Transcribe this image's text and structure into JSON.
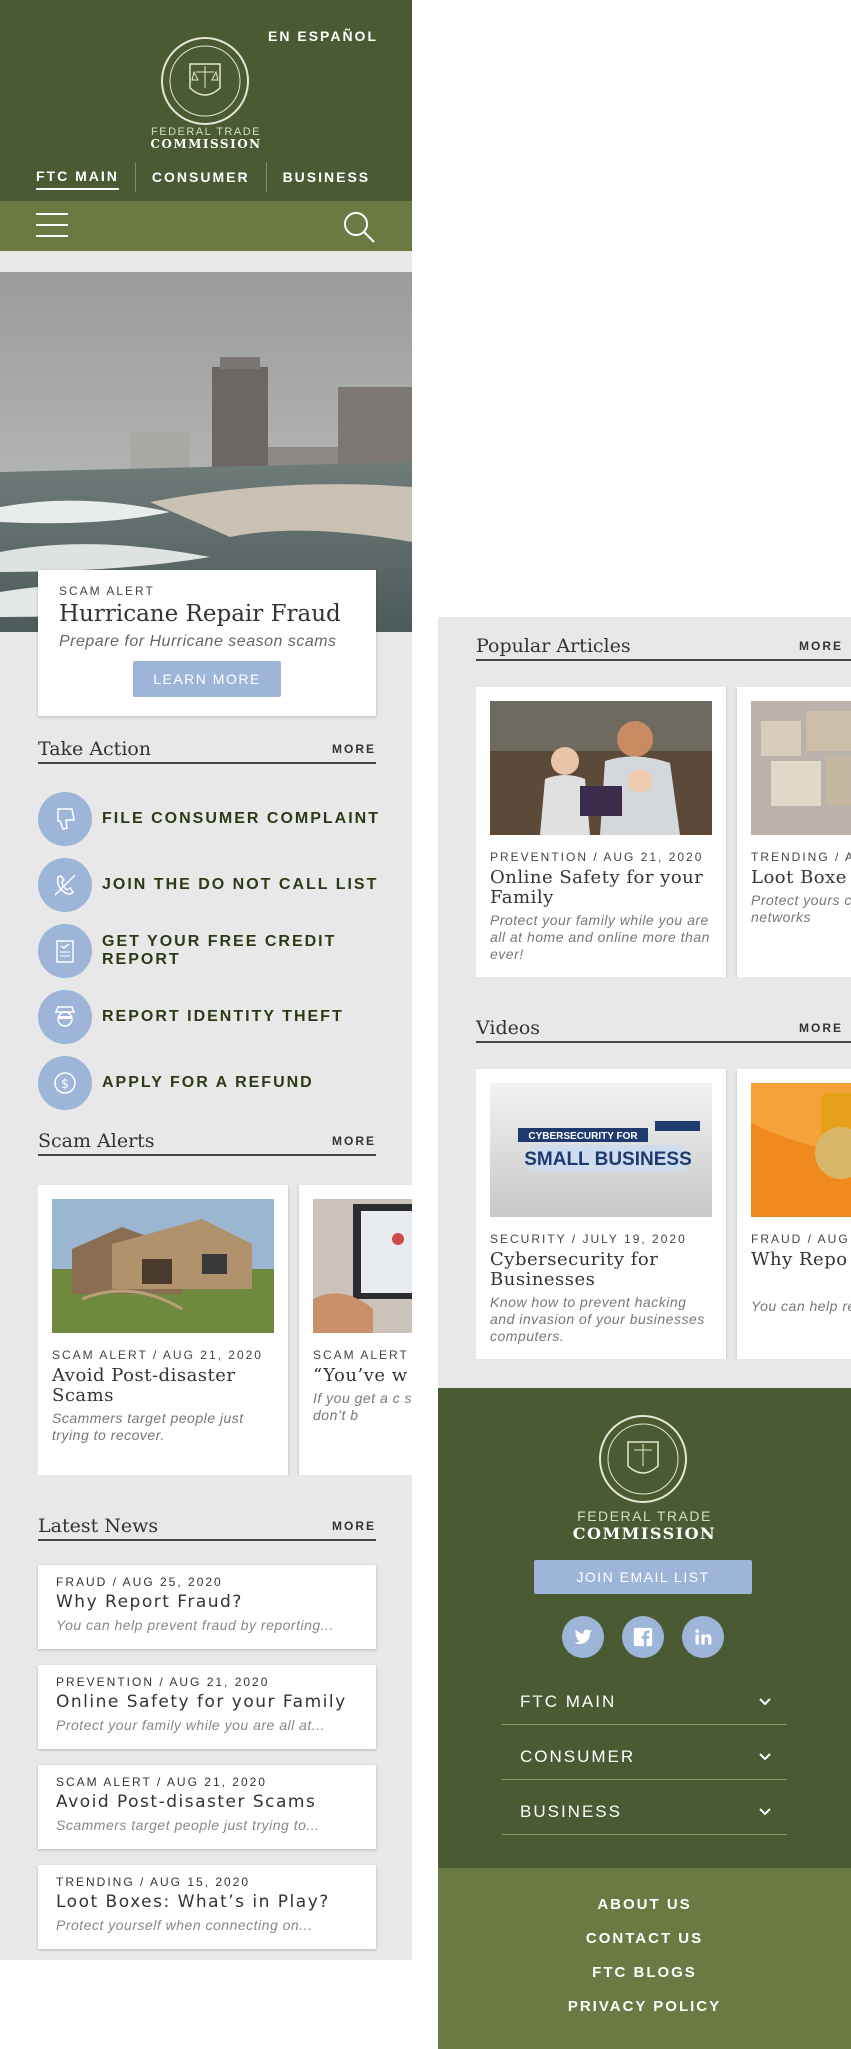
{
  "header": {
    "language_link": "EN ESPAÑOL",
    "org_line1": "FEDERAL TRADE",
    "org_line2": "COMMISSION",
    "nav": [
      "FTC MAIN",
      "CONSUMER",
      "BUSINESS"
    ]
  },
  "hero": {
    "kicker": "SCAM ALERT",
    "title": "Hurricane Repair Fraud",
    "description": "Prepare for Hurricane season scams",
    "button": "LEARN MORE"
  },
  "take_action": {
    "title": "Take Action",
    "more": "MORE",
    "items": [
      {
        "label": "FILE CONSUMER COMPLAINT",
        "icon": "thumbs-down-icon"
      },
      {
        "label": "JOIN THE DO NOT CALL LIST",
        "icon": "no-phone-icon"
      },
      {
        "label": "GET YOUR FREE CREDIT REPORT",
        "icon": "report-document-icon"
      },
      {
        "label": "REPORT IDENTITY THEFT",
        "icon": "masked-thief-icon"
      },
      {
        "label": "APPLY FOR A REFUND",
        "icon": "refund-coin-icon"
      }
    ]
  },
  "scam_alerts": {
    "title": "Scam Alerts",
    "more": "MORE",
    "cards": [
      {
        "meta": "SCAM ALERT / AUG 21, 2020",
        "title": "Avoid Post-disaster Scams",
        "desc": "Scammers target people just trying to recover."
      },
      {
        "meta": "SCAM ALERT",
        "title": "“You’ve w pay us” S",
        "desc": "If you get a c someone say won,” don’t b"
      }
    ]
  },
  "latest_news": {
    "title": "Latest News",
    "more": "MORE",
    "items": [
      {
        "meta": "FRAUD / AUG 25, 2020",
        "title": "Why Report Fraud?",
        "desc": "You can help prevent fraud by reporting..."
      },
      {
        "meta": "PREVENTION / AUG 21, 2020",
        "title": "Online Safety for your Family",
        "desc": "Protect your family while you are all at..."
      },
      {
        "meta": "SCAM ALERT / AUG 21, 2020",
        "title": "Avoid Post-disaster Scams",
        "desc": "Scammers target people just trying to..."
      },
      {
        "meta": "TRENDING / AUG 15, 2020",
        "title": "Loot Boxes: What’s in Play?",
        "desc": "Protect yourself when connecting on..."
      }
    ]
  },
  "popular_articles": {
    "title": "Popular Articles",
    "more": "MORE",
    "cards": [
      {
        "meta": "PREVENTION / AUG 21, 2020",
        "title": "Online Safety for your Family",
        "desc": "Protect your family while you are all at home and online more than ever!"
      },
      {
        "meta": "TRENDING / A",
        "title": "Loot Boxe Play?",
        "desc": "Protect yours connecting o networks"
      }
    ]
  },
  "videos": {
    "title": "Videos",
    "more": "MORE",
    "cards": [
      {
        "meta": "SECURITY / JULY 19, 2020",
        "title": "Cybersecurity for Businesses",
        "desc": "Know how to prevent hacking and invasion of your businesses computers.",
        "thumb_line1": "CYBERSECURITY FOR",
        "thumb_line2": "SMALL BUSINESS"
      },
      {
        "meta": "FRAUD / AUG",
        "title": "Why Repo",
        "desc": "You can help reporting it."
      }
    ]
  },
  "footer": {
    "org_line1": "FEDERAL TRADE",
    "org_line2": "COMMISSION",
    "email_button": "JOIN EMAIL LIST",
    "socials": [
      "twitter-icon",
      "facebook-icon",
      "linkedin-icon"
    ],
    "nav": [
      "FTC MAIN",
      "CONSUMER",
      "BUSINESS"
    ],
    "links": [
      "ABOUT US",
      "CONTACT US",
      "FTC BLOGS",
      "PRIVACY POLICY"
    ]
  },
  "colors": {
    "header_dark_green": "#4a5a32",
    "header_light_green": "#6a7a42",
    "accent_blue": "#9cb5d8",
    "page_gray": "#e8e8e8"
  }
}
